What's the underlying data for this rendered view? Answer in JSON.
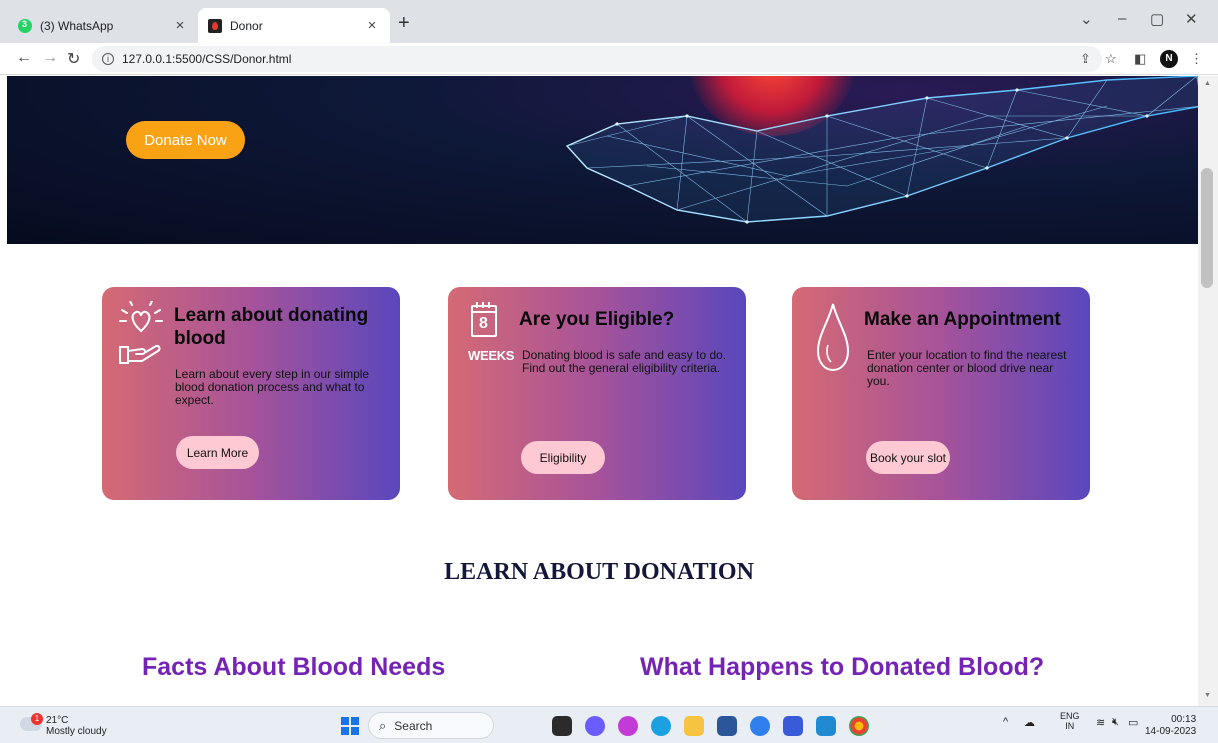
{
  "browser": {
    "tabs": [
      {
        "title": "(3) WhatsApp",
        "active": false
      },
      {
        "title": "Donor",
        "active": true
      }
    ],
    "new_tab_glyph": "+",
    "url": "127.0.0.1:5500/CSS/Donor.html",
    "profile_initial": "N",
    "icons": [
      "back-icon",
      "forward-icon",
      "reload-icon",
      "share-icon",
      "star-icon",
      "sidepanel-icon",
      "menu-icon"
    ]
  },
  "hero": {
    "donate_label": "Donate Now"
  },
  "cards": [
    {
      "title": "Learn about donating blood",
      "description": "Learn about every step in our simple blood donation process and what to expect.",
      "button": "Learn More",
      "icon": "heart-hand-icon"
    },
    {
      "title": "Are you Eligible?",
      "description": "Donating blood is safe and easy to do. Find out the general eligibility criteria.",
      "button": "Eligibility",
      "icon": "calendar-8-weeks-icon",
      "icon_number": "8",
      "icon_caption": "WEEKS"
    },
    {
      "title": "Make an Appointment",
      "description": "Enter your location to find the nearest donation center or blood drive near you.",
      "button": "Book your slot",
      "icon": "blood-drop-icon"
    }
  ],
  "section": {
    "heading": "LEARN ABOUT DONATION",
    "left_subheading": "Facts About Blood Needs",
    "right_subheading": "What Happens to Donated Blood?"
  },
  "taskbar": {
    "weather_temp": "21°C",
    "weather_desc": "Mostly cloudy",
    "weather_badge": "1",
    "search_label": "Search",
    "lang_top": "ENG",
    "lang_bottom": "IN",
    "time": "00:13",
    "date": "14-09-2023"
  },
  "colors": {
    "donate_button": "#f9a214",
    "card_gradient_start": "#d56a74",
    "card_gradient_end": "#5a47bd",
    "card_button": "#ffc9d4",
    "subheading": "#7424b5",
    "heading": "#14163a"
  }
}
